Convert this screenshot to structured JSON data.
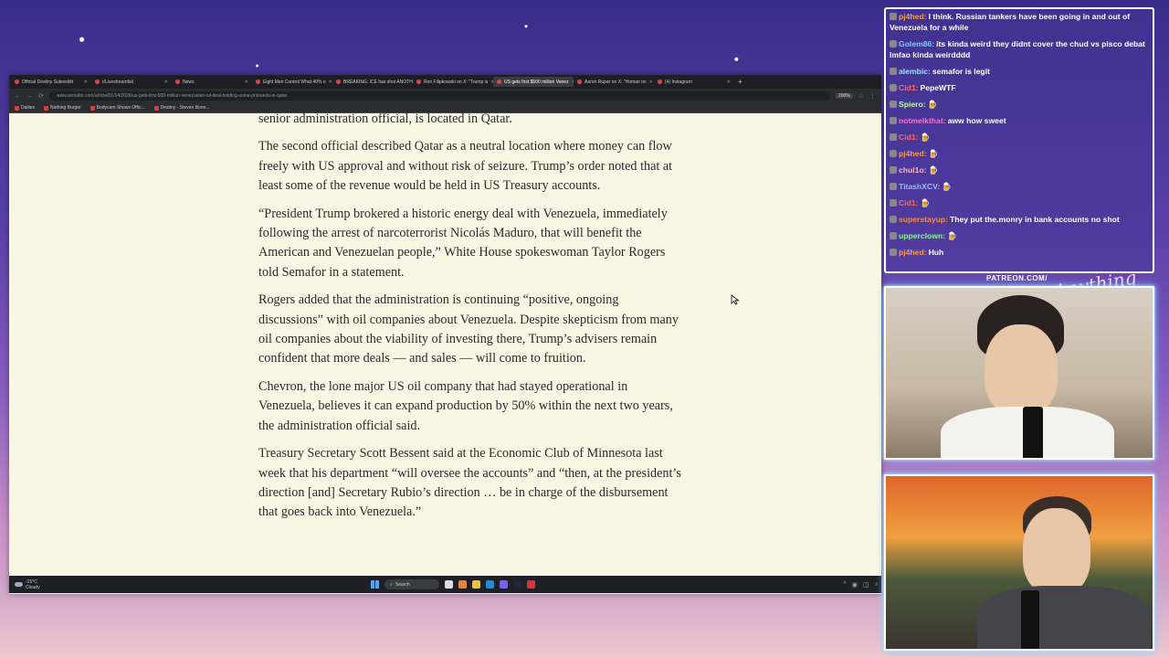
{
  "browser": {
    "tabs": [
      {
        "label": "Official Destiny Subreddit",
        "active": false
      },
      {
        "label": "r/Livestreamfail",
        "active": false
      },
      {
        "label": "News",
        "active": false
      },
      {
        "label": "Eight Men Control What 40% o",
        "active": false
      },
      {
        "label": "BREAKING: ICE has shot ANOTH",
        "active": false
      },
      {
        "label": "Ron Filipkowski on X: \"Trump is",
        "active": false
      },
      {
        "label": "US gets first $500 million Venez",
        "active": true
      },
      {
        "label": "Aaron Rupar on X: \"Homan on",
        "active": false
      },
      {
        "label": "(4) Instagram",
        "active": false
      }
    ],
    "url": "www.semafor.com/article/01/14/2026/us-gets-first-500-million-venezuelan-oil-deal-holding-some-proceeds-in-qatar",
    "zoom": "200%",
    "bookmarks": [
      "Dailies",
      "Nothing Burger",
      "Bodycam Shows Offic...",
      "Destiny - Steven Bonn..."
    ]
  },
  "article": {
    "paragraphs": [
      "senior administration official, is located in Qatar.",
      "The second official described Qatar as a neutral location where money can flow freely with US approval and without risk of seizure. Trump’s order noted that at least some of the revenue would be held in US Treasury accounts.",
      "“President Trump brokered a historic energy deal with Venezuela, immediately following the arrest of narcoterrorist Nicolás Maduro, that will benefit the American and Venezuelan people,” White House spokeswoman Taylor Rogers told Semafor in a statement.",
      "Rogers added that the administration is continuing “positive, ongoing discussions” with oil companies about Venezuela. Despite skepticism from many oil companies about the viability of investing there, Trump’s advisers remain confident that more deals — and sales — will come to fruition.",
      "Chevron, the lone major US oil company that had stayed operational in Venezuela, believes it can expand production by 50% within the next two years, the administration official said.",
      "Treasury Secretary Scott Bessent said at the Economic Club of Minnesota last week that his department “will oversee the accounts” and “then, at the president’s direction [and] Secretary Rubio’s direction … be in charge of the disbursement that goes back into Venezuela.”"
    ]
  },
  "taskbar": {
    "weather_temp": "-15°C",
    "weather_desc": "Cloudy",
    "search_label": "Search"
  },
  "chat": {
    "messages": [
      {
        "user": "pj4hed:",
        "color": "#ff9a3c",
        "text": "I think. Russian tankers have been going in and out of Venezuela for a while"
      },
      {
        "user": "Golem86:",
        "color": "#7fc6ff",
        "text": "its kinda weird they didnt cover the chud vs pisco debat lmfao kinda weirdddd"
      },
      {
        "user": "alembic:",
        "color": "#9fe0ff",
        "text": "semafor is legit"
      },
      {
        "user": "Cid1:",
        "color": "#ff6a6a",
        "text": "PepeWTF"
      },
      {
        "user": "Spiero:",
        "color": "#b8ff9a",
        "text": "🍺"
      },
      {
        "user": "notmelkthat:",
        "color": "#ff6fd0",
        "text": "aww how sweet"
      },
      {
        "user": "Cid1:",
        "color": "#ff6a6a",
        "text": "🍺"
      },
      {
        "user": "pj4hed:",
        "color": "#ff9a3c",
        "text": "🍺"
      },
      {
        "user": "chul1o:",
        "color": "#ffb3c8",
        "text": "🍺"
      },
      {
        "user": "TitashXCV:",
        "color": "#9fb8ff",
        "text": "🍺"
      },
      {
        "user": "Cid1:",
        "color": "#ff6a6a",
        "text": "🍺"
      },
      {
        "user": "superstayup:",
        "color": "#ff8a3c",
        "text": "They put the.monry in bank accounts no shot"
      },
      {
        "user": "upperclown:",
        "color": "#7fff7f",
        "text": "🍺"
      },
      {
        "user": "pj4hed:",
        "color": "#ff9a3c",
        "text": "Huh"
      }
    ]
  },
  "overlay": {
    "patreon": "PATREON.COM/",
    "signature": "Anything Goes"
  }
}
